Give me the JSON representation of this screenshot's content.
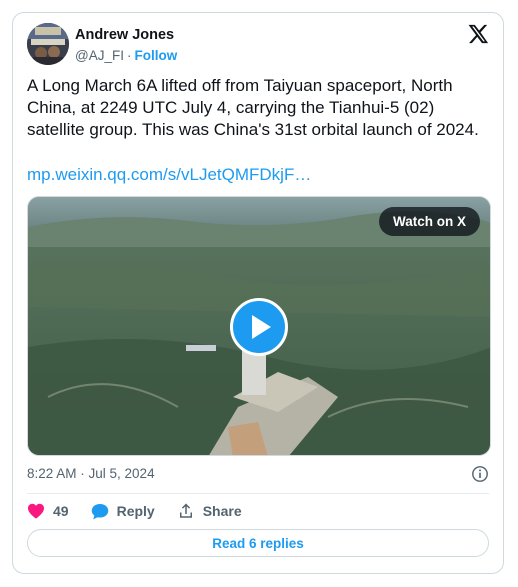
{
  "author": {
    "name": "Andrew Jones",
    "handle": "@AJ_FI",
    "separator": "·",
    "follow_label": "Follow"
  },
  "tweet": {
    "text": "A Long March 6A lifted off from Taiyuan spaceport, North China, at 2249 UTC July 4, carrying the Tianhui-5 (02) satellite group. This was China's 31st orbital launch of 2024.",
    "link": "mp.weixin.qq.com/s/vLJetQMFDkjF…"
  },
  "media": {
    "watch_label": "Watch on X",
    "play_icon": "play-icon"
  },
  "meta": {
    "timestamp": "8:22 AM · Jul 5, 2024"
  },
  "actions": {
    "like_count": "49",
    "reply_label": "Reply",
    "share_label": "Share"
  },
  "footer": {
    "read_replies_label": "Read 6 replies"
  },
  "colors": {
    "accent": "#1d9bf0",
    "like": "#f91880",
    "text": "#0f1419",
    "muted": "#536471"
  }
}
